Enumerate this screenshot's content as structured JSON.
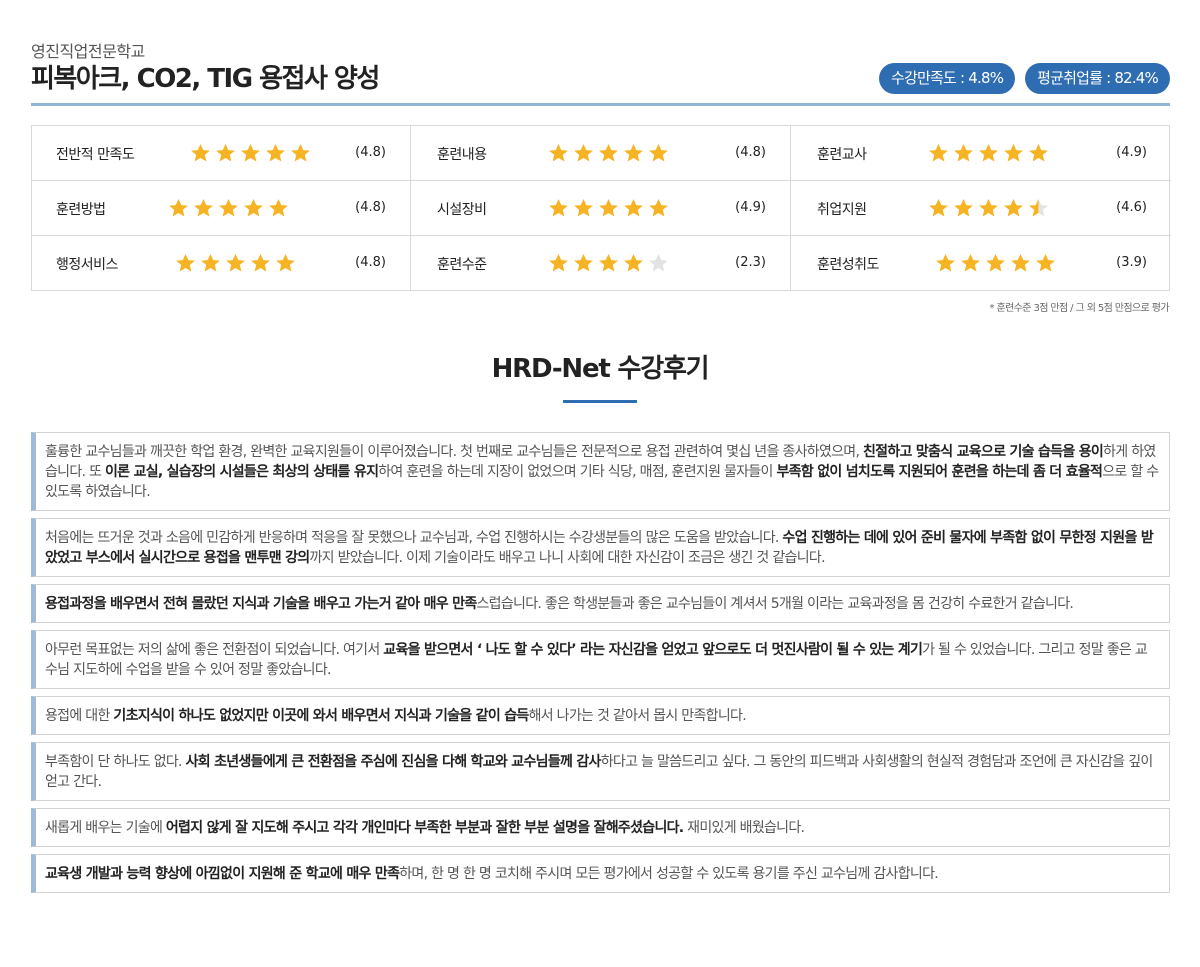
{
  "header": {
    "school": "영진직업전문학교",
    "title": "피복아크, CO2, TIG 용접사 양성",
    "satisfaction_badge": "수강만족도 : 4.8%",
    "employment_badge": "평균취업률 : 82.4%"
  },
  "ratings": [
    {
      "label": "전반적 만족도",
      "score": "(4.8)",
      "stars": 5
    },
    {
      "label": "훈련내용",
      "score": "(4.8)",
      "stars": 5
    },
    {
      "label": "훈련교사",
      "score": "(4.9)",
      "stars": 5
    },
    {
      "label": "훈련방법",
      "score": "(4.8)",
      "stars": 5
    },
    {
      "label": "시설장비",
      "score": "(4.9)",
      "stars": 5
    },
    {
      "label": "취업지원",
      "score": "(4.6)",
      "stars": 4.5
    },
    {
      "label": "행정서비스",
      "score": "(4.8)",
      "stars": 5
    },
    {
      "label": "훈련수준",
      "score": "(2.3)",
      "stars": 4
    },
    {
      "label": "훈련성취도",
      "score": "(3.9)",
      "stars": 5
    }
  ],
  "footnote": "* 훈련수준 3점 만점 / 그 외 5점 만점으로 평가",
  "section_title": "HRD-Net 수강후기",
  "reviews": [
    [
      {
        "t": "훌륭한 교수님들과 깨끗한 학업 환경, 완벽한 교육지원들이 이루어졌습니다. 첫 번째로 교수님들은 전문적으로 용접 관련하여 몇십 년을 종사하였으며, ",
        "b": false
      },
      {
        "t": "친절하고 맞춤식 교육으로 기술 습득을 용이",
        "b": true
      },
      {
        "t": "하게 하였습니다. 또 ",
        "b": false
      },
      {
        "t": "이론 교실, 실습장의 시설들은 최상의 상태를 유지",
        "b": true
      },
      {
        "t": "하여 훈련을 하는데 지장이 없었으며 기타 식당, 매점, 훈련지원 물자들이 ",
        "b": false
      },
      {
        "t": "부족함 없이 넘치도록 지원되어 훈련을 하는데 좀 더 효율적",
        "b": true
      },
      {
        "t": "으로 할 수 있도록 하였습니다.",
        "b": false
      }
    ],
    [
      {
        "t": "처음에는 뜨거운 것과 소음에 민감하게 반응하며 적응을 잘 못했으나 교수님과, 수업 진행하시는 수강생분들의 많은 도움을 받았습니다. ",
        "b": false
      },
      {
        "t": "수업 진행하는 데에 있어 준비 물자에 부족함 없이 무한정 지원을 받았었고 부스에서 실시간으로 용접을 맨투맨 강의",
        "b": true
      },
      {
        "t": "까지 받았습니다. 이제 기술이라도 배우고 나니 사회에 대한 자신감이 조금은 생긴 것 같습니다.",
        "b": false
      }
    ],
    [
      {
        "t": "용접과정을 배우면서 전혀 몰랐던 지식과 기술을 배우고 가는거 같아 매우 만족",
        "b": true
      },
      {
        "t": "스럽습니다. 좋은 학생분들과 좋은 교수님들이 계셔서 5개월 이라는 교육과정을 몸 건강히 수료한거 같습니다.",
        "b": false
      }
    ],
    [
      {
        "t": "아무런 목표없는 저의 삶에 좋은 전환점이 되었습니다. 여기서 ",
        "b": false
      },
      {
        "t": "교육을 받으면서 ‘ 나도 할 수 있다’ 라는 자신감을 얻었고 앞으로도 더 멋진사람이 될 수 있는 계기",
        "b": true
      },
      {
        "t": "가 될 수 있었습니다. 그리고 정말 좋은 교수님 지도하에 수업을 받을 수 있어 정말 좋았습니다.",
        "b": false
      }
    ],
    [
      {
        "t": "용접에 대한 ",
        "b": false
      },
      {
        "t": "기초지식이 하나도 없었지만 이곳에 와서 배우면서 지식과 기술을 같이 습득",
        "b": true
      },
      {
        "t": "해서 나가는 것 같아서 몹시 만족합니다.",
        "b": false
      }
    ],
    [
      {
        "t": "부족함이 단 하나도 없다. ",
        "b": false
      },
      {
        "t": "사회 초년생들에게 큰 전환점을 주심에 진심을 다해 학교와 교수님들께 감사",
        "b": true
      },
      {
        "t": "하다고 늘 말씀드리고 싶다. 그 동안의 피드백과 사회생활의 현실적 경험담과 조언에 큰 자신감을 깊이 얻고 간다.",
        "b": false
      }
    ],
    [
      {
        "t": "새롭게 배우는 기술에 ",
        "b": false
      },
      {
        "t": "어렵지 않게 잘 지도해 주시고 각각 개인마다 부족한 부분과 잘한 부분 설명을 잘해주셨습니다.",
        "b": true
      },
      {
        "t": " 재미있게 배웠습니다.",
        "b": false
      }
    ],
    [
      {
        "t": "교육생 개발과 능력 향상에 아낌없이 지원해 준 학교에 매우 만족",
        "b": true
      },
      {
        "t": "하며, 한 명 한 명 코치해 주시며 모든 평가에서 성공할 수 있도록 용기를 주신 교수님께 감사합니다.",
        "b": false
      }
    ]
  ],
  "colors": {
    "accent": "#2f6db3",
    "star_gold": "#f6b323",
    "star_empty": "#e3e3e3",
    "review_border": "#9dbbd9"
  }
}
